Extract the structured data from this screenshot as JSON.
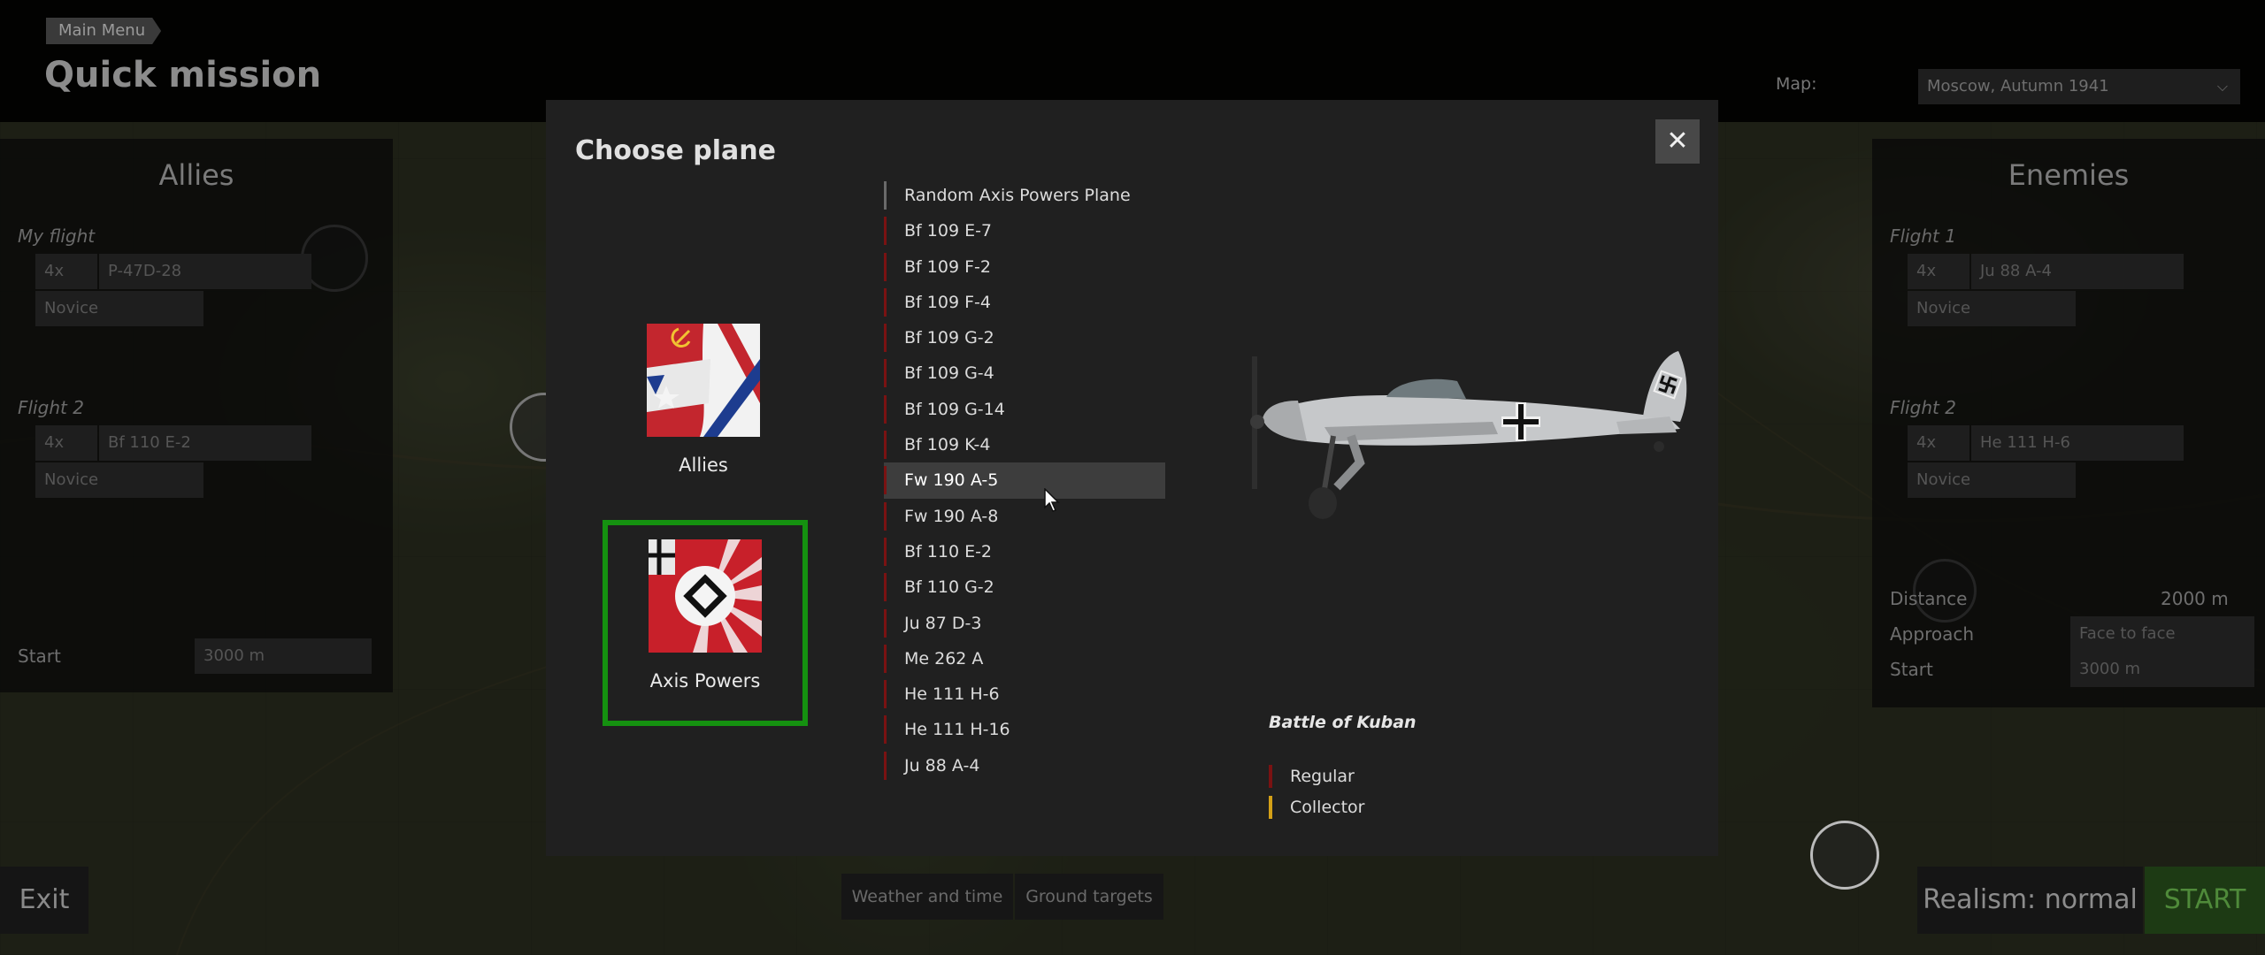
{
  "header": {
    "breadcrumb": "Main Menu",
    "title": "Quick mission",
    "map_label": "Map:",
    "map_value": "Moscow, Autumn 1941"
  },
  "allies_panel": {
    "title": "Allies",
    "flight1_label": "My flight",
    "flight1_count": "4x",
    "flight1_plane": "P-47D-28",
    "flight1_skill": "Novice",
    "flight2_label": "Flight 2",
    "flight2_count": "4x",
    "flight2_plane": "Bf 110 E-2",
    "flight2_skill": "Novice",
    "start_label": "Start",
    "start_value": "3000 m"
  },
  "enemies_panel": {
    "title": "Enemies",
    "flight1_label": "Flight 1",
    "flight1_count": "4x",
    "flight1_plane": "Ju 88 A-4",
    "flight1_skill": "Novice",
    "flight2_label": "Flight 2",
    "flight2_count": "4x",
    "flight2_plane": "He 111 H-6",
    "flight2_skill": "Novice",
    "distance_label": "Distance",
    "distance_value": "2000 m",
    "approach_label": "Approach",
    "approach_value": "Face to face",
    "start_label": "Start",
    "start_value": "3000 m"
  },
  "bottom_bar": {
    "exit": "Exit",
    "weather": "Weather and time",
    "ground_targets": "Ground targets",
    "realism": "Realism: normal",
    "start": "START"
  },
  "modal": {
    "title": "Choose plane",
    "close_glyph": "✕",
    "sides": [
      {
        "label": "Allies",
        "selected": false
      },
      {
        "label": "Axis Powers",
        "selected": true
      }
    ],
    "planes": [
      {
        "name": "Random Axis Powers Plane",
        "type": "random"
      },
      {
        "name": "Bf 109 E-7",
        "type": "regular"
      },
      {
        "name": "Bf 109 F-2",
        "type": "regular"
      },
      {
        "name": "Bf 109 F-4",
        "type": "regular"
      },
      {
        "name": "Bf 109 G-2",
        "type": "regular"
      },
      {
        "name": "Bf 109 G-4",
        "type": "regular"
      },
      {
        "name": "Bf 109 G-14",
        "type": "regular"
      },
      {
        "name": "Bf 109 K-4",
        "type": "regular"
      },
      {
        "name": "Fw 190 A-5",
        "type": "regular",
        "selected": true
      },
      {
        "name": "Fw 190 A-8",
        "type": "regular"
      },
      {
        "name": "Bf 110 E-2",
        "type": "regular"
      },
      {
        "name": "Bf 110 G-2",
        "type": "regular"
      },
      {
        "name": "Ju 87 D-3",
        "type": "regular"
      },
      {
        "name": "Me 262 A",
        "type": "regular"
      },
      {
        "name": "He 111 H-6",
        "type": "regular"
      },
      {
        "name": "He 111 H-16",
        "type": "regular"
      },
      {
        "name": "Ju 88 A-4",
        "type": "regular"
      }
    ],
    "battle_name": "Battle of Kuban",
    "legend": [
      {
        "label": "Regular",
        "color": "#7a1212"
      },
      {
        "label": "Collector",
        "color": "#d4a017"
      }
    ]
  },
  "colors": {
    "selected_border": "#159110",
    "regular": "#7a1212",
    "collector": "#d4a017",
    "random": "#6a6a6a",
    "start_bg": "#1d3a14"
  }
}
